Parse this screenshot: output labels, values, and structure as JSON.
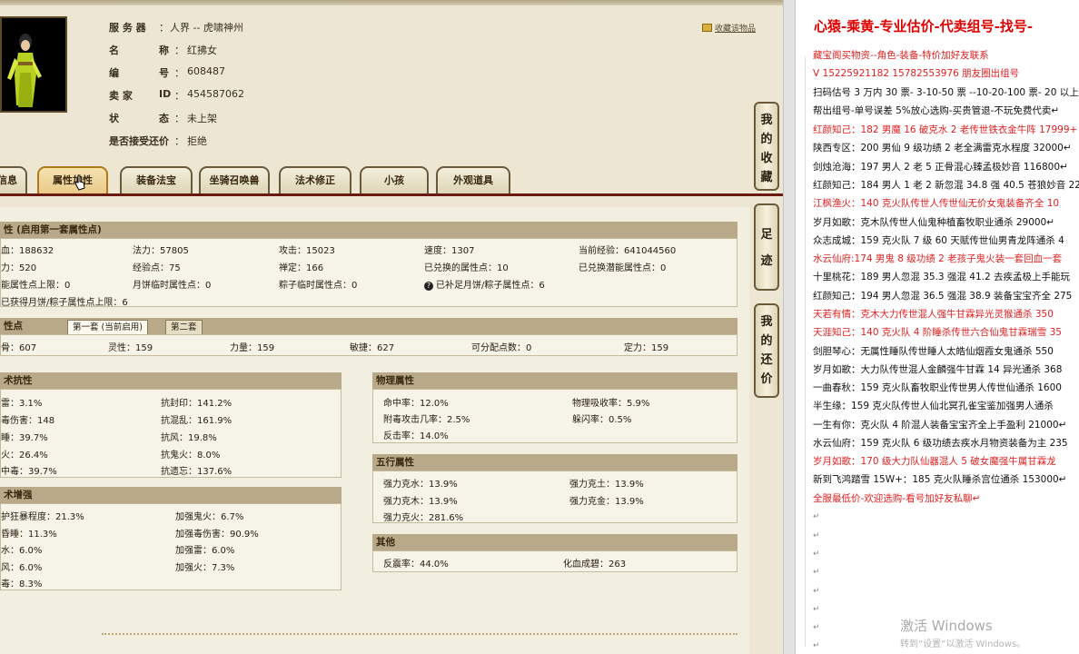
{
  "role_info": {
    "fields": [
      {
        "key": "服 务 器",
        "value": "人界 -- 虎啸神州"
      },
      {
        "key": "名",
        "key2": "称",
        "value": "红拂女"
      },
      {
        "key": "编",
        "key2": "号",
        "value": "608487"
      },
      {
        "key": "卖 家",
        "key2": "ID",
        "value": "454587062"
      },
      {
        "key": "状",
        "key2": "态",
        "value": "未上架"
      },
      {
        "key": "是否接受还价",
        "value": "拒绝"
      }
    ],
    "favorite": "收藏该物品"
  },
  "tabs": [
    "信息",
    "属性加性",
    "装备法宝",
    "坐骑召唤兽",
    "法术修正",
    "小孩",
    "外观道具"
  ],
  "active_tab": 1,
  "side_buttons": [
    [
      "我",
      "的",
      "收",
      "藏"
    ],
    [
      "足",
      "迹"
    ],
    [
      "我",
      "的",
      "还",
      "价"
    ]
  ],
  "basic": {
    "title": "性 (启用第一套属性点)",
    "rows": [
      [
        "血：188632",
        "法力：57805",
        "攻击：15023",
        "速度：1307",
        "当前经验：641044560"
      ],
      [
        "力：520",
        "经验点：75",
        "禅定：166",
        "已兑换的属性点：10",
        "已兑换潜能属性点：0"
      ],
      [
        "能属性点上限：0",
        "月饼临时属性点：0",
        "粽子临时属性点：0",
        "已补足月饼/粽子属性点：6",
        ""
      ],
      [
        "已获得月饼/粽子属性点上限：6",
        "",
        "",
        "",
        ""
      ]
    ]
  },
  "points": {
    "title": "性点",
    "subtabs": [
      "第一套 (当前启用)",
      "第二套"
    ],
    "values": [
      "骨：607",
      "灵性：159",
      "力量：159",
      "敏捷：627",
      "可分配点数：0",
      "定力：159"
    ]
  },
  "resist": {
    "title": "术抗性",
    "rows": [
      [
        "雷：3.1%",
        "抗封印：141.2%"
      ],
      [
        "毒伤害：148",
        "抗混乱：161.9%"
      ],
      [
        "睡：39.7%",
        "抗风：19.8%"
      ],
      [
        "火：26.4%",
        "抗鬼火：8.0%"
      ],
      [
        "中毒：39.7%",
        "抗遗忘：137.6%"
      ]
    ]
  },
  "boost": {
    "title": "术增强",
    "rows": [
      [
        "护狂暴程度：21.3%",
        "加强鬼火：6.7%"
      ],
      [
        "昏睡：11.3%",
        "加强毒伤害：90.9%"
      ],
      [
        "水：6.0%",
        "加强雷：6.0%"
      ],
      [
        "风：6.0%",
        "加强火：7.3%"
      ],
      [
        "毒：8.3%",
        ""
      ]
    ]
  },
  "physical": {
    "title": "物理属性",
    "rows": [
      [
        "命中率：12.0%",
        "物理吸收率：5.9%"
      ],
      [
        "附毒攻击几率：2.5%",
        "躲闪率：0.5%"
      ],
      [
        "反击率：14.0%",
        ""
      ]
    ]
  },
  "five": {
    "title": "五行属性",
    "rows": [
      [
        "强力克水：13.9%",
        "强力克土：13.9%"
      ],
      [
        "强力克木：13.9%",
        "强力克金：13.9%"
      ],
      [
        "强力克火：281.6%",
        ""
      ]
    ]
  },
  "other": {
    "title": "其他",
    "rows": [
      [
        "反震率：44.0%",
        "化血成碧：263"
      ]
    ]
  },
  "doc": {
    "title": "心猿-乘黄-专业估价-代卖组号-找号-",
    "lines": [
      {
        "t": "藏宝阁买物资--角色-装备-特价加好友联系",
        "c": "red"
      },
      {
        "t": "V 15225921182  15782553976 朋友圈出组号",
        "c": "red"
      },
      {
        "t": "扫码估号 3 万内 30 票- 3-10-50 票  --10-20-100 票- 20 以上 1",
        "c": "blk"
      },
      {
        "t": "帮出组号-单号误差 5%放心选购-买贵管退-不玩免费代卖↵",
        "c": "blk"
      },
      {
        "t": "红颜知己：182 男魔 16 破克水 2 老传世铁衣金牛阵 17999+",
        "c": "red"
      },
      {
        "t": "陕西专区：200 男仙 9 级功绩 2 老全满雷克水程度 32000↵",
        "c": "blk"
      },
      {
        "t": "剑烛沧海：197 男人 2 老 5 正骨混心臻孟极妙音 116800↵",
        "c": "blk"
      },
      {
        "t": "红颜知己：184 男人 1 老 2 新忽混 34.8 强 40.5 苍狼妙音 22",
        "c": "blk"
      },
      {
        "t": "江枫渔火：140 克火队传世人传世仙无价女鬼装备齐全 10",
        "c": "red"
      },
      {
        "t": "岁月如歌：克木队传世人仙鬼种植畜牧职业通杀 29000↵",
        "c": "blk"
      },
      {
        "t": "众志成城：159 克火队 7 级 60 天赋传世仙男青龙阵通杀 4",
        "c": "blk"
      },
      {
        "t": "水云仙府:174 男鬼 8 级功绩 2 老孩子鬼火装一套回血一套",
        "c": "red"
      },
      {
        "t": "十里桃花：189 男人忽混 35.3 强混 41.2 去疾孟极上手能玩",
        "c": "blk"
      },
      {
        "t": "红颜知己：194 男人忽混 36.5 强混 38.9 装备宝宝齐全 275",
        "c": "blk"
      },
      {
        "t": "天若有情：克木大力传世混人强牛甘霖异光灵猴通杀 350",
        "c": "red"
      },
      {
        "t": "天涯知己：140 克火队 4 阶睡杀传世六合仙鬼甘霖瑞雪 35",
        "c": "red"
      },
      {
        "t": "剑胆琴心：无属性睡队传世睡人太皓仙烟霞女鬼通杀 550",
        "c": "blk"
      },
      {
        "t": "岁月如歌：大力队传世混人金麟强牛甘霖 14 异光通杀 368",
        "c": "blk"
      },
      {
        "t": "一曲春秋：159 克火队畜牧职业传世男人传世仙通杀 1600",
        "c": "blk"
      },
      {
        "t": "半生缘：159 克火队传世人仙北冥孔雀宝鉴加强男人通杀",
        "c": "blk"
      },
      {
        "t": "一生有你：克火队 4 阶混人装备宝宝齐全上手盈利 21000↵",
        "c": "blk"
      },
      {
        "t": "水云仙府：159 克火队 6 级功绩去疾水月物资装备为主 235",
        "c": "blk"
      },
      {
        "t": "岁月如歌：170 级大力队仙器混人 5 破女魔强牛属甘霖龙 ",
        "c": "red"
      },
      {
        "t": "新到飞鸿踏雪 15W+：185 克火队睡杀宫位通杀 153000↵",
        "c": "blk"
      },
      {
        "t": "全服最低价-欢迎选购-看号加好友私聊↵",
        "c": "red"
      }
    ],
    "returns": [
      "↵",
      "↵",
      "↵",
      "↵",
      "↵",
      "↵",
      "↵",
      "↵"
    ],
    "activate": "激活 Windows",
    "activate_sub": "转到“设置”以激活 Windows。"
  }
}
